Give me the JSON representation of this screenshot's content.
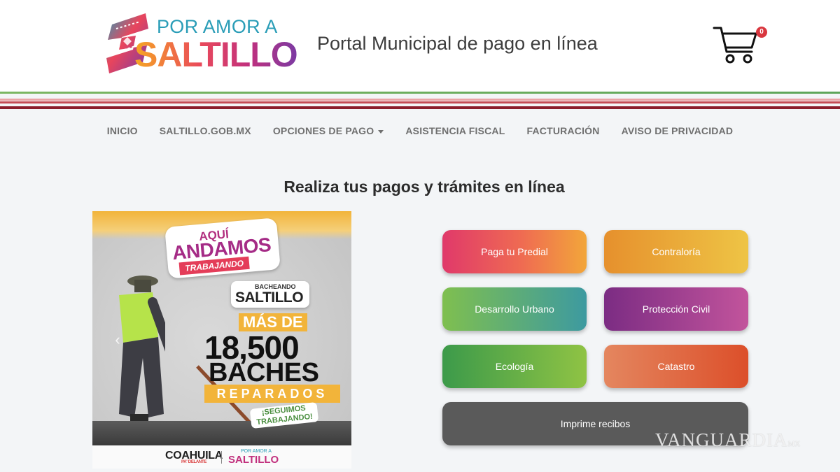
{
  "header": {
    "logo_line1": "POR AMOR A",
    "logo_line2": "SALTILLO",
    "portal_title": "Portal Municipal de pago en línea",
    "cart_count": "0",
    "cart_icon": "shopping-cart-icon"
  },
  "nav": {
    "items": [
      "INICIO",
      "SALTILLO.GOB.MX",
      "OPCIONES DE PAGO",
      "ASISTENCIA FISCAL",
      "FACTURACIÓN",
      "AVISO DE PRIVACIDAD"
    ]
  },
  "main": {
    "section_title": "Realiza tus pagos y trámites en línea"
  },
  "carousel": {
    "slide": {
      "sticker_line1": "AQUÍ",
      "sticker_line2": "ANDAMOS",
      "sticker_line3": "TRABAJANDO",
      "bach_small": "BACHEANDO",
      "bach_big": "SALTILLO",
      "mas_de": "MÁS DE",
      "number": "18,500",
      "baches": "BACHES",
      "reparados": "REPARADOS",
      "seguimos_line1": "¡SEGUIMOS",
      "seguimos_line2": "TRABAJANDO!",
      "footer_coahuila": "COAHUILA",
      "footer_coahuila_sub": "PA' DELANTE",
      "footer_por_amor": "POR AMOR A",
      "footer_saltillo": "SALTILLO"
    },
    "prev_glyph": "‹",
    "next_glyph": "›"
  },
  "buttons": {
    "predial": "Paga tu Predial",
    "contraloria": "Contraloría",
    "desarrollo": "Desarrollo Urbano",
    "proteccion": "Protección Civil",
    "ecologia": "Ecología",
    "catastro": "Catastro",
    "recibos": "Imprime recibos"
  },
  "watermark": {
    "text": "VANGUARDIA",
    "suffix": "MX"
  },
  "colors": {
    "brand_teal": "#2a9db7",
    "brand_magenta": "#c1307d",
    "badge_red": "#d9373f",
    "nav_text": "#6f6f6f"
  }
}
